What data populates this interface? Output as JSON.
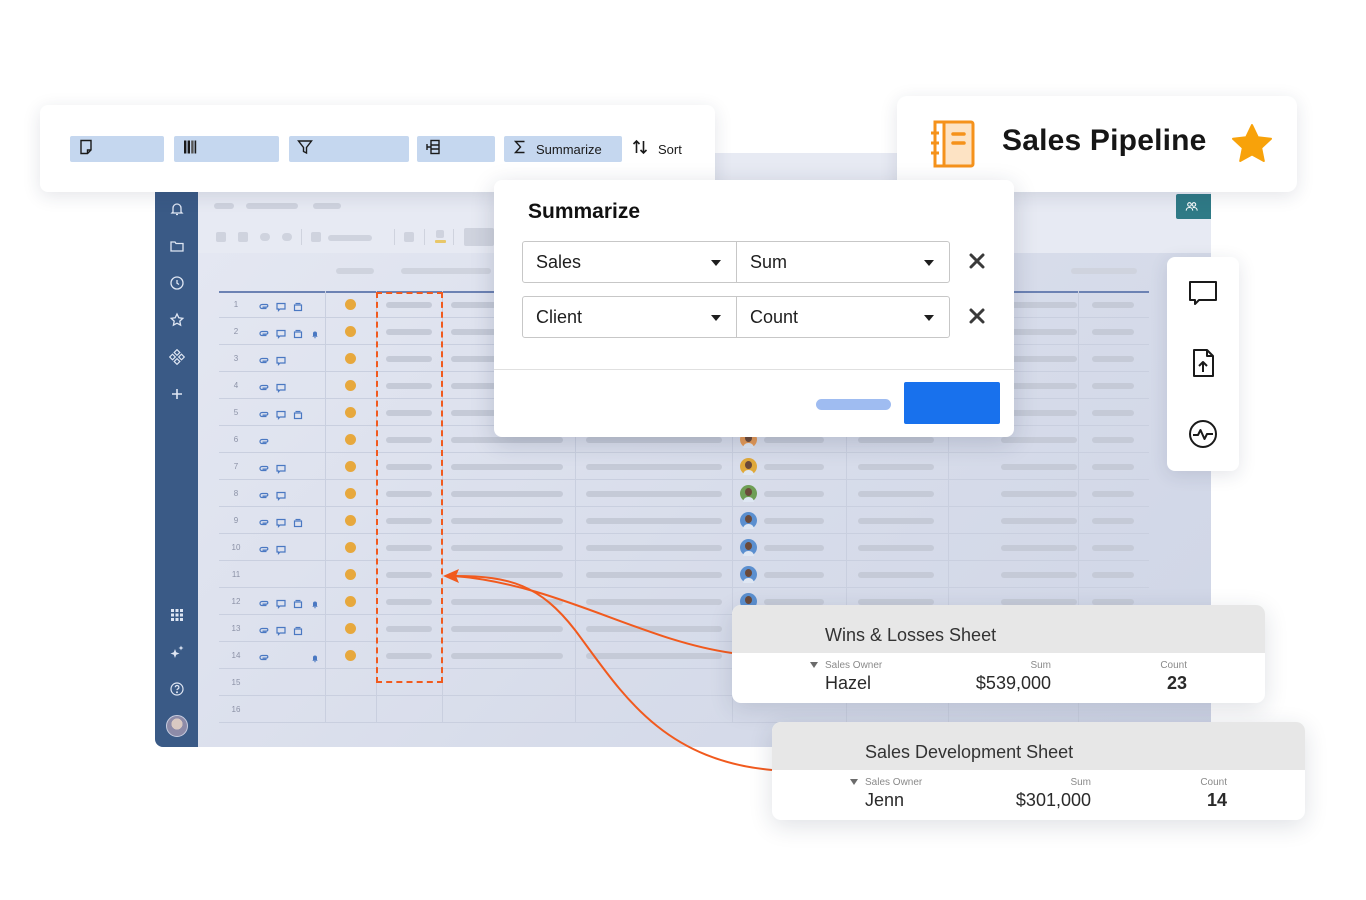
{
  "toolbar": {
    "buttons": [
      {
        "name": "new-sheet",
        "icon": "page-icon",
        "label": ""
      },
      {
        "name": "columns",
        "icon": "columns-icon",
        "label": ""
      },
      {
        "name": "filter",
        "icon": "filter-icon",
        "label": ""
      },
      {
        "name": "hierarchy",
        "icon": "hierarchy-icon",
        "label": ""
      },
      {
        "name": "summarize",
        "icon": "sigma-icon",
        "label": "Summarize"
      }
    ],
    "sort_label": "Sort"
  },
  "title_card": {
    "title": "Sales Pipeline",
    "icon": "notebook-icon",
    "favorite_icon": "star-icon",
    "accent": "#f5921b"
  },
  "dialog": {
    "title": "Summarize",
    "rows": [
      {
        "field": "Sales",
        "function": "Sum"
      },
      {
        "field": "Client",
        "function": "Count"
      }
    ],
    "cancel_label": "",
    "ok_label": "",
    "ok_color": "#1871ed"
  },
  "side_panel": {
    "icons": [
      "comment-icon",
      "file-upload-icon",
      "activity-icon"
    ]
  },
  "sheet": {
    "rows": [
      {
        "num": "1",
        "icons": [
          "attach",
          "comment",
          "proof"
        ],
        "status": true
      },
      {
        "num": "2",
        "icons": [
          "attach",
          "comment",
          "proof",
          "reminder"
        ],
        "status": true
      },
      {
        "num": "3",
        "icons": [
          "attach",
          "comment"
        ],
        "status": true
      },
      {
        "num": "4",
        "icons": [
          "attach",
          "comment"
        ],
        "status": true
      },
      {
        "num": "5",
        "icons": [
          "attach",
          "comment",
          "proof"
        ],
        "status": true
      },
      {
        "num": "6",
        "icons": [
          "attach"
        ],
        "status": true
      },
      {
        "num": "7",
        "icons": [
          "attach",
          "comment"
        ],
        "status": true
      },
      {
        "num": "8",
        "icons": [
          "attach",
          "comment"
        ],
        "status": true
      },
      {
        "num": "9",
        "icons": [
          "attach",
          "comment",
          "proof"
        ],
        "status": true
      },
      {
        "num": "10",
        "icons": [
          "attach",
          "comment"
        ],
        "status": true
      },
      {
        "num": "11",
        "icons": [],
        "status": true
      },
      {
        "num": "12",
        "icons": [
          "attach",
          "comment",
          "proof",
          "reminder"
        ],
        "status": true
      },
      {
        "num": "13",
        "icons": [
          "attach",
          "comment",
          "proof"
        ],
        "status": true
      },
      {
        "num": "14",
        "icons": [
          "attach",
          "reminder"
        ],
        "status": true
      },
      {
        "num": "15",
        "icons": [],
        "status": false
      },
      {
        "num": "16",
        "icons": [],
        "status": false
      }
    ],
    "status_color": "#e7a83d",
    "nav_color": "#3a5a86",
    "highlight_color": "#f15a1e"
  },
  "results": [
    {
      "title": "Wins & Losses Sheet",
      "group_label": "Sales Owner",
      "group_value": "Hazel",
      "sum_label": "Sum",
      "sum_value": "$539,000",
      "count_label": "Count",
      "count_value": "23"
    },
    {
      "title": "Sales Development Sheet",
      "group_label": "Sales Owner",
      "group_value": "Jenn",
      "sum_label": "Sum",
      "sum_value": "$301,000",
      "count_label": "Count",
      "count_value": "14"
    }
  ]
}
